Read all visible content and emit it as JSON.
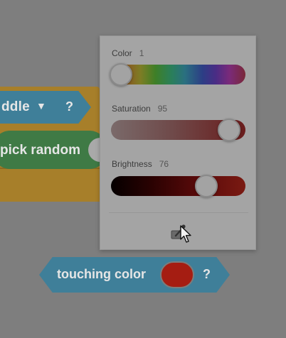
{
  "blocks": {
    "sensing_dropdown": {
      "label": "ddle",
      "arrow": "▼",
      "question": "?"
    },
    "operator": {
      "label": "pick random"
    },
    "touching": {
      "label": "touching color",
      "question": "?",
      "swatch_color": "#a51d12"
    }
  },
  "color_picker": {
    "color": {
      "label": "Color",
      "value": "1"
    },
    "saturation": {
      "label": "Saturation",
      "value": "95"
    },
    "brightness": {
      "label": "Brightness",
      "value": "76"
    },
    "eyedropper_icon": "eyedropper-icon"
  },
  "icons": {
    "cursor": "pointer-cursor-icon",
    "dropdown": "triangle-down-icon"
  },
  "colors": {
    "sensing_block": "#3f7f99",
    "operator_block": "#3f7a45",
    "control_block": "#a77f2a",
    "selected_color": "#a51d12"
  }
}
